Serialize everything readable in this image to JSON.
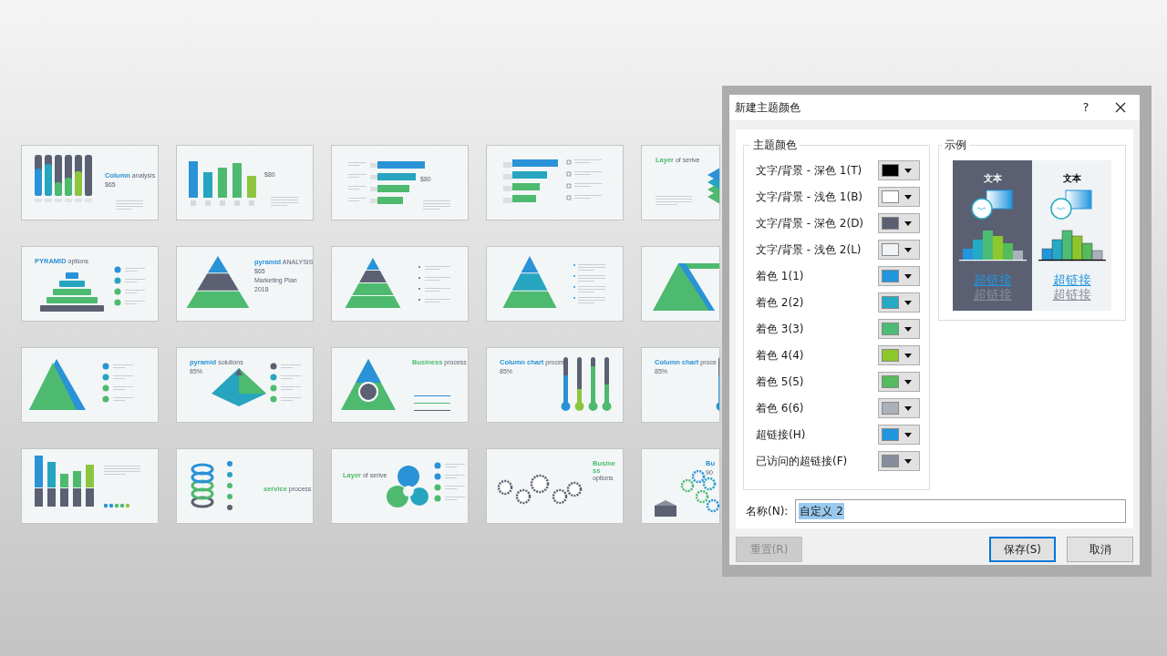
{
  "slides": [
    {
      "kind": "columns",
      "title": {
        "accent": "Column",
        "rest": "analysis",
        "color": "#2a92d6"
      },
      "figures": [
        "$65"
      ]
    },
    {
      "kind": "bars",
      "figures": [
        "$80"
      ]
    },
    {
      "kind": "hbars",
      "figures": [
        "$80"
      ]
    },
    {
      "kind": "hbars-icons"
    },
    {
      "kind": "layers",
      "title": {
        "accent": "Layer",
        "rest": "of serive",
        "color": "#4dba6f"
      }
    },
    {
      "kind": "pyramid-steps",
      "title": {
        "accent": "PYRAMID",
        "rest": "options",
        "color": "#2a92d6"
      }
    },
    {
      "kind": "pyramid",
      "title": {
        "accent": "pyramid",
        "rest": "ANALYSIS",
        "color": "#2a92d6"
      },
      "figures": [
        "$65",
        "Marketing Plan",
        "2018"
      ]
    },
    {
      "kind": "pyramid-list"
    },
    {
      "kind": "pyramid-dots"
    },
    {
      "kind": "ribbon"
    },
    {
      "kind": "triangle"
    },
    {
      "kind": "pyramid3d",
      "title": {
        "accent": "pyramid",
        "rest": "solutions",
        "color": "#2a92d6"
      },
      "figures": [
        "85%"
      ]
    },
    {
      "kind": "cycle",
      "title": {
        "accent": "Business",
        "rest": "process",
        "color": "#4dba6f"
      }
    },
    {
      "kind": "thermo",
      "title": {
        "accent": "Column chart",
        "rest": "proces",
        "color": "#2a92d6"
      },
      "figures": [
        "85%"
      ]
    },
    {
      "kind": "thermo",
      "title": {
        "accent": "Column chart",
        "rest": "proce",
        "color": "#2a92d6"
      },
      "figures": [
        "85%"
      ]
    },
    {
      "kind": "stack-bars"
    },
    {
      "kind": "rings",
      "title": {
        "accent": "service",
        "rest": "process",
        "color": "#4dba6f"
      }
    },
    {
      "kind": "flower",
      "title": {
        "accent": "Layer",
        "rest": "of serive",
        "color": "#4dba6f"
      }
    },
    {
      "kind": "gears",
      "title": {
        "accent": "Busine ss",
        "rest": "options",
        "color": "#4dba6f"
      }
    },
    {
      "kind": "cube",
      "title": {
        "accent": "Bu",
        "color": "#2a92d6"
      },
      "figures": [
        "90"
      ]
    }
  ],
  "dialog": {
    "title": "新建主题颜色",
    "help": "?",
    "theme_group": {
      "title": "主题颜色",
      "rows": [
        {
          "label": "文字/背景 - 深色 1(T)",
          "color": "#000000"
        },
        {
          "label": "文字/背景 - 浅色 1(B)",
          "color": "#ffffff"
        },
        {
          "label": "文字/背景 - 深色 2(D)",
          "color": "#5a5f72"
        },
        {
          "label": "文字/背景 - 浅色 2(L)",
          "color": "#f0f3f5"
        },
        {
          "label": "着色 1(1)",
          "color": "#2196dd"
        },
        {
          "label": "着色 2(2)",
          "color": "#25a9c4"
        },
        {
          "label": "着色 3(3)",
          "color": "#4cbc74"
        },
        {
          "label": "着色 4(4)",
          "color": "#8cc82c"
        },
        {
          "label": "着色 5(5)",
          "color": "#55bb5c"
        },
        {
          "label": "着色 6(6)",
          "color": "#aab1bb"
        },
        {
          "label": "超链接(H)",
          "color": "#2196dd"
        },
        {
          "label": "已访问的超链接(F)",
          "color": "#888d9c"
        }
      ]
    },
    "preview": {
      "title": "示例",
      "panels": [
        {
          "heading": "文本",
          "link": "超链接",
          "visited_link": "超链接"
        },
        {
          "heading": "文本",
          "link": "超链接",
          "visited_link": "超链接"
        }
      ]
    },
    "name_field": {
      "label": "名称(N):",
      "value": "自定义 2",
      "selected": true
    },
    "buttons": [
      {
        "label": "重置(R)",
        "disabled": true,
        "default": false
      },
      {
        "label": "保存(S)",
        "disabled": false,
        "default": true
      },
      {
        "label": "取消",
        "disabled": false,
        "default": false
      }
    ]
  }
}
